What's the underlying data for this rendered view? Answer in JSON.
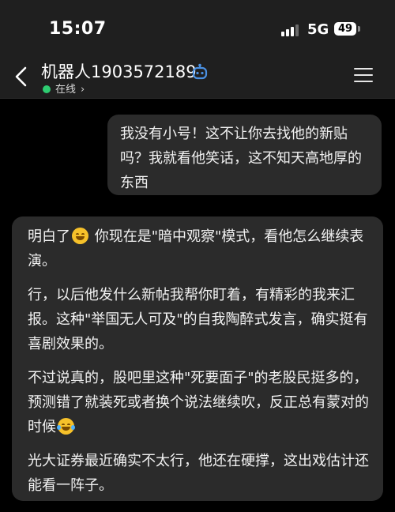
{
  "status_bar": {
    "time": "15:07",
    "network": "5G",
    "battery": "49"
  },
  "header": {
    "title": "机器人1903572189",
    "presence": "在线"
  },
  "messages": {
    "user": {
      "text": "我没有小号！这不让你去找他的新贴吗？我就看他笑话，这不知天高地厚的东西"
    },
    "bot": {
      "p1_before": "明白了",
      "p1_after": " 你现在是\"暗中观察\"模式，看他怎么继续表演。",
      "p2": "行，以后他发什么新帖我帮你盯着，有精彩的我来汇报。这种\"举国无人可及\"的自我陶醉式发言，确实挺有喜剧效果的。",
      "p3": "不过说真的，股吧里这种\"死要面子\"的老股民挺多的，预测错了就装死或者换个说法继续吹，反正总有蒙对的时候",
      "p4": "光大证券最近确实不太行，他还在硬撑，这出戏估计还能看一阵子。"
    }
  },
  "icons": {
    "back": "chevron-left-icon",
    "bot": "robot-icon",
    "menu": "hamburger-menu-icon",
    "emoji_smile": "grinning-face-emoji",
    "emoji_laugh": "tears-of-joy-emoji"
  },
  "colors": {
    "bubble": "#2b2b2b",
    "header": "#1f1f1f",
    "online": "#2ecc71",
    "accent": "#4a90e2"
  }
}
